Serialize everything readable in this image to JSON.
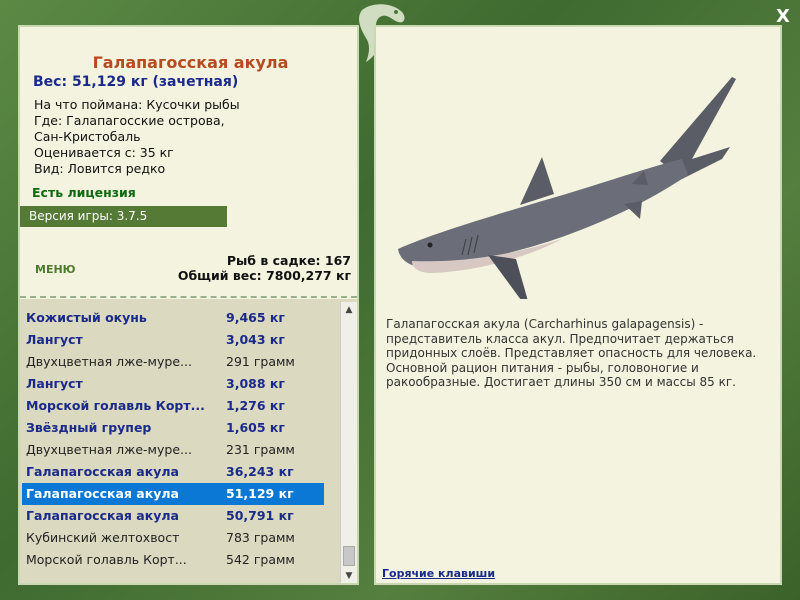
{
  "header": {
    "close_label": "X"
  },
  "fish": {
    "title": "Галапагосская акула",
    "weight": "Вес: 51,129 кг (зачетная)",
    "info_lines": [
      "На что поймана: Кусочки рыбы",
      "Где: Галапагосские острова,",
      "Сан-Кристобаль",
      "Оценивается с: 35 кг",
      "Вид: Ловится редко"
    ],
    "license": "Есть лицензия",
    "description": "Галапагосская акула (Carcharhinus galapagensis) - представитель класса акул. Предпочитает держаться придонных слоёв. Представляет опасность для человека. Основной рацион питания - рыбы, головоногие и ракообразные. Достигает длины 350 см и массы 85 кг."
  },
  "version": "Версия игры: 3.7.5",
  "menu_label": "МЕНЮ",
  "summary": {
    "count": "Рыб в садке: 167",
    "total_weight": "Общий вес: 7800,277 кг"
  },
  "catch_list": [
    {
      "name": "Кожистый окунь",
      "weight": "9,465 кг",
      "style": "big"
    },
    {
      "name": "Лангуст",
      "weight": "3,043 кг",
      "style": "big"
    },
    {
      "name": "Двухцветная лже-муре...",
      "weight": "291 грамм",
      "style": "small"
    },
    {
      "name": "Лангуст",
      "weight": "3,088 кг",
      "style": "big"
    },
    {
      "name": "Морской голавль Корт...",
      "weight": "1,276 кг",
      "style": "big"
    },
    {
      "name": "Звёздный групер",
      "weight": "1,605 кг",
      "style": "big"
    },
    {
      "name": "Двухцветная лже-муре...",
      "weight": "231 грамм",
      "style": "small"
    },
    {
      "name": "Галапагосская акула",
      "weight": "36,243 кг",
      "style": "big"
    },
    {
      "name": "Галапагосская акула",
      "weight": "51,129 кг",
      "style": "big selected"
    },
    {
      "name": "Галапагосская акула",
      "weight": "50,791 кг",
      "style": "big"
    },
    {
      "name": "Кубинский желтохвост",
      "weight": "783 грамм",
      "style": "small"
    },
    {
      "name": "Морской голавль Корт...",
      "weight": "542 грамм",
      "style": "small"
    }
  ],
  "hotkeys_label": "Горячие клавиши",
  "colors": {
    "frame": "#4b7a3a",
    "panel": "#f4f3df",
    "list_bg": "#dbd9bf",
    "title": "#b84a20",
    "accent_blue": "#1a2a8a",
    "selection": "#0a78d4",
    "license_green": "#0f6a0f"
  },
  "icons": {
    "logo": "fish-logo-icon",
    "close": "close-icon",
    "scroll_up": "scroll-up-icon",
    "scroll_down": "scroll-down-icon"
  }
}
